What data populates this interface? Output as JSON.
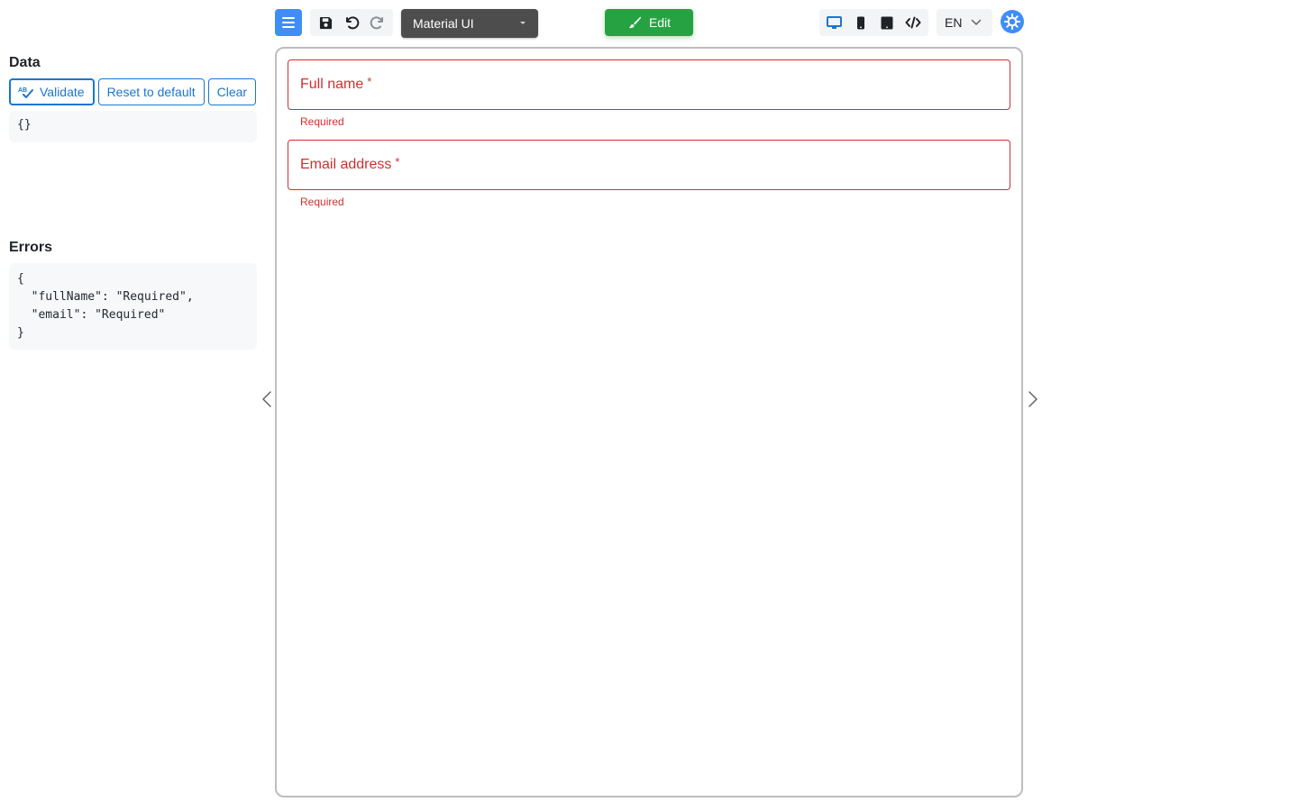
{
  "left_panel": {
    "data_heading": "Data",
    "actions": {
      "validate_label": "Validate",
      "reset_label": "Reset to default",
      "clear_label": "Clear"
    },
    "data_json": "{}",
    "errors_heading": "Errors",
    "errors_json": "{\n  \"fullName\": \"Required\",\n  \"email\": \"Required\"\n}"
  },
  "toolbar": {
    "theme_value": "Material UI",
    "edit_label": "Edit",
    "language_value": "EN",
    "icons": [
      "menu-icon",
      "save-icon",
      "undo-icon",
      "redo-icon",
      "desktop-icon",
      "tablet-icon",
      "mobile-icon",
      "code-icon",
      "chevron-down-icon",
      "settings-icon"
    ]
  },
  "form": {
    "fields": [
      {
        "label": "Full name",
        "required_mark": "*",
        "helper": "Required"
      },
      {
        "label": "Email address",
        "required_mark": "*",
        "helper": "Required"
      }
    ]
  },
  "colors": {
    "primary": "#1976d2",
    "accent_blue": "#3f8ef7",
    "edit_green": "#27a243",
    "error_red": "#d32f2f",
    "theme_select_bg": "#4d4d4d"
  }
}
